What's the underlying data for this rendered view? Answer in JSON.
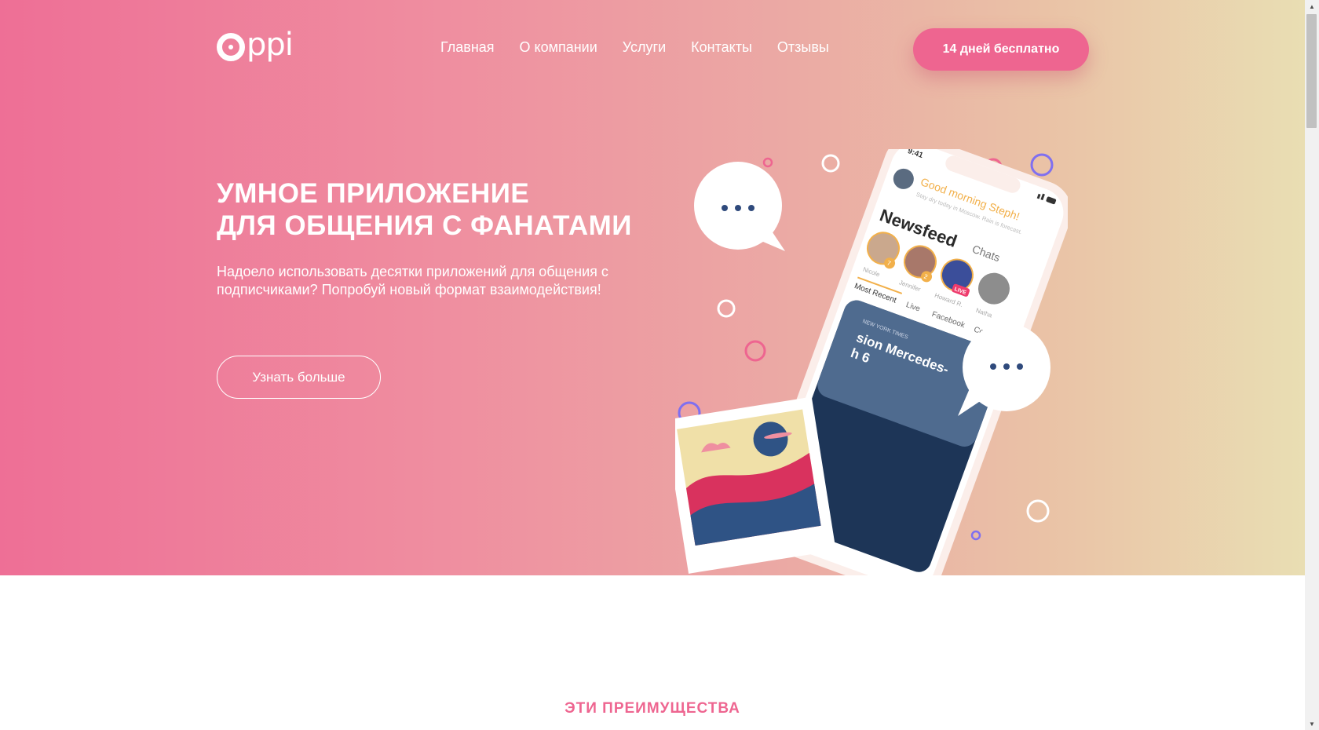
{
  "header": {
    "logo_text": "ppi",
    "nav": [
      "Главная",
      "О компании",
      "Услуги",
      "Контакты",
      "Отзывы"
    ],
    "cta_label": "14 дней бесплатно"
  },
  "hero": {
    "title_line1": "УМНОЕ ПРИЛОЖЕНИЕ",
    "title_line2": "ДЛЯ ОБЩЕНИЯ С ФАНАТАМИ",
    "subtitle": "Надоело использовать десятки приложений для общения с подписчиками? Попробуй новый формат взаимодействия!",
    "button_label": "Узнать больше"
  },
  "phone": {
    "time": "9:41",
    "greeting": "Good morning Steph!",
    "weather": "Stay dry today in Moscow. Rain is forecast.",
    "tab_newsfeed": "Newsfeed",
    "tab_chats": "Chats",
    "stories": [
      {
        "name": "Nicole",
        "badge": "7"
      },
      {
        "name": "Jennifer",
        "badge": "2"
      },
      {
        "name": "Howard R.",
        "badge": "LIVE"
      },
      {
        "name": "Natha"
      }
    ],
    "filters": [
      "Most Recent",
      "Live",
      "Facebook",
      "Commu"
    ],
    "card_source": "NEW YORK TIMES",
    "card_title_line1": "sion Mercedes-",
    "card_title_line2": "h 6"
  },
  "section": {
    "title": "ЭТИ ПРЕИМУЩЕСТВА"
  },
  "colors": {
    "accent": "#ee6590",
    "gradient_start": "#ee6f96",
    "gradient_end": "#e9deb3"
  },
  "icons": [
    "logo-icon",
    "chat-bubble-icon",
    "photo-icon",
    "scroll-up-icon",
    "scroll-down-icon"
  ]
}
